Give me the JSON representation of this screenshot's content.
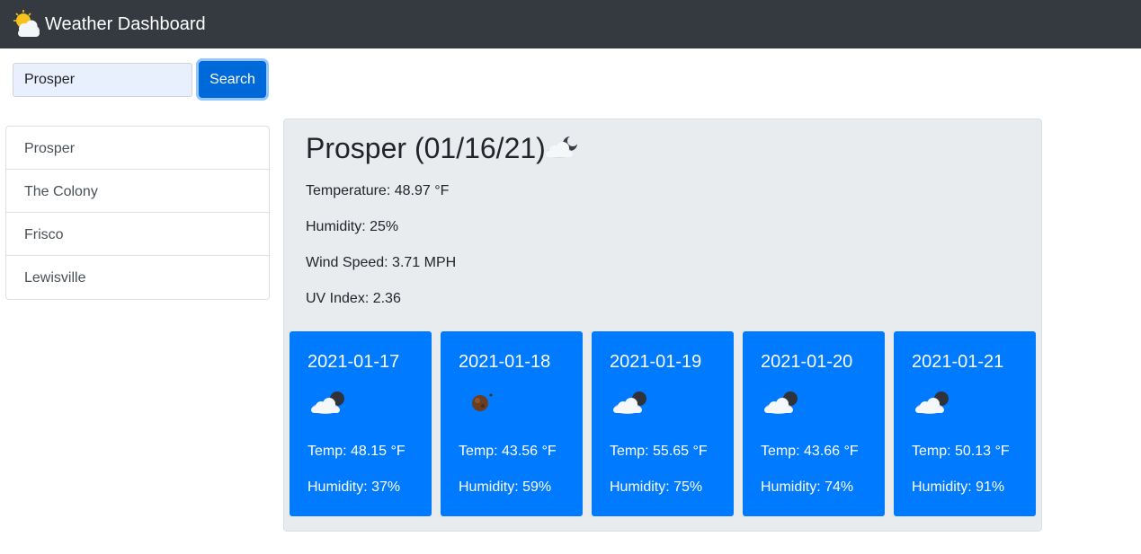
{
  "header": {
    "title": "Weather Dashboard",
    "icon": "sun-behind-cloud-icon"
  },
  "search": {
    "value": "Prosper",
    "button_label": "Search"
  },
  "history": [
    "Prosper",
    "The Colony",
    "Frisco",
    "Lewisville"
  ],
  "current": {
    "title": "Prosper (01/16/21)",
    "icon": "cloud-night-icon",
    "temperature": "Temperature: 48.97 °F",
    "humidity": "Humidity: 25%",
    "wind": "Wind Speed: 3.71 MPH",
    "uv": "UV Index: 2.36"
  },
  "forecast": [
    {
      "date": "2021-01-17",
      "icon": "cloud-night-icon",
      "temp": "Temp: 48.15 °F",
      "humidity": "Humidity: 37%"
    },
    {
      "date": "2021-01-18",
      "icon": "clear-night-icon",
      "temp": "Temp: 43.56 °F",
      "humidity": "Humidity: 59%"
    },
    {
      "date": "2021-01-19",
      "icon": "cloud-night-icon",
      "temp": "Temp: 55.65 °F",
      "humidity": "Humidity: 75%"
    },
    {
      "date": "2021-01-20",
      "icon": "cloud-night-icon",
      "temp": "Temp: 43.66 °F",
      "humidity": "Humidity: 74%"
    },
    {
      "date": "2021-01-21",
      "icon": "cloud-night-icon",
      "temp": "Temp: 50.13 °F",
      "humidity": "Humidity: 91%"
    }
  ],
  "colors": {
    "navbar": "#343a40",
    "accent": "#007bff",
    "panel": "#e9ecef"
  }
}
